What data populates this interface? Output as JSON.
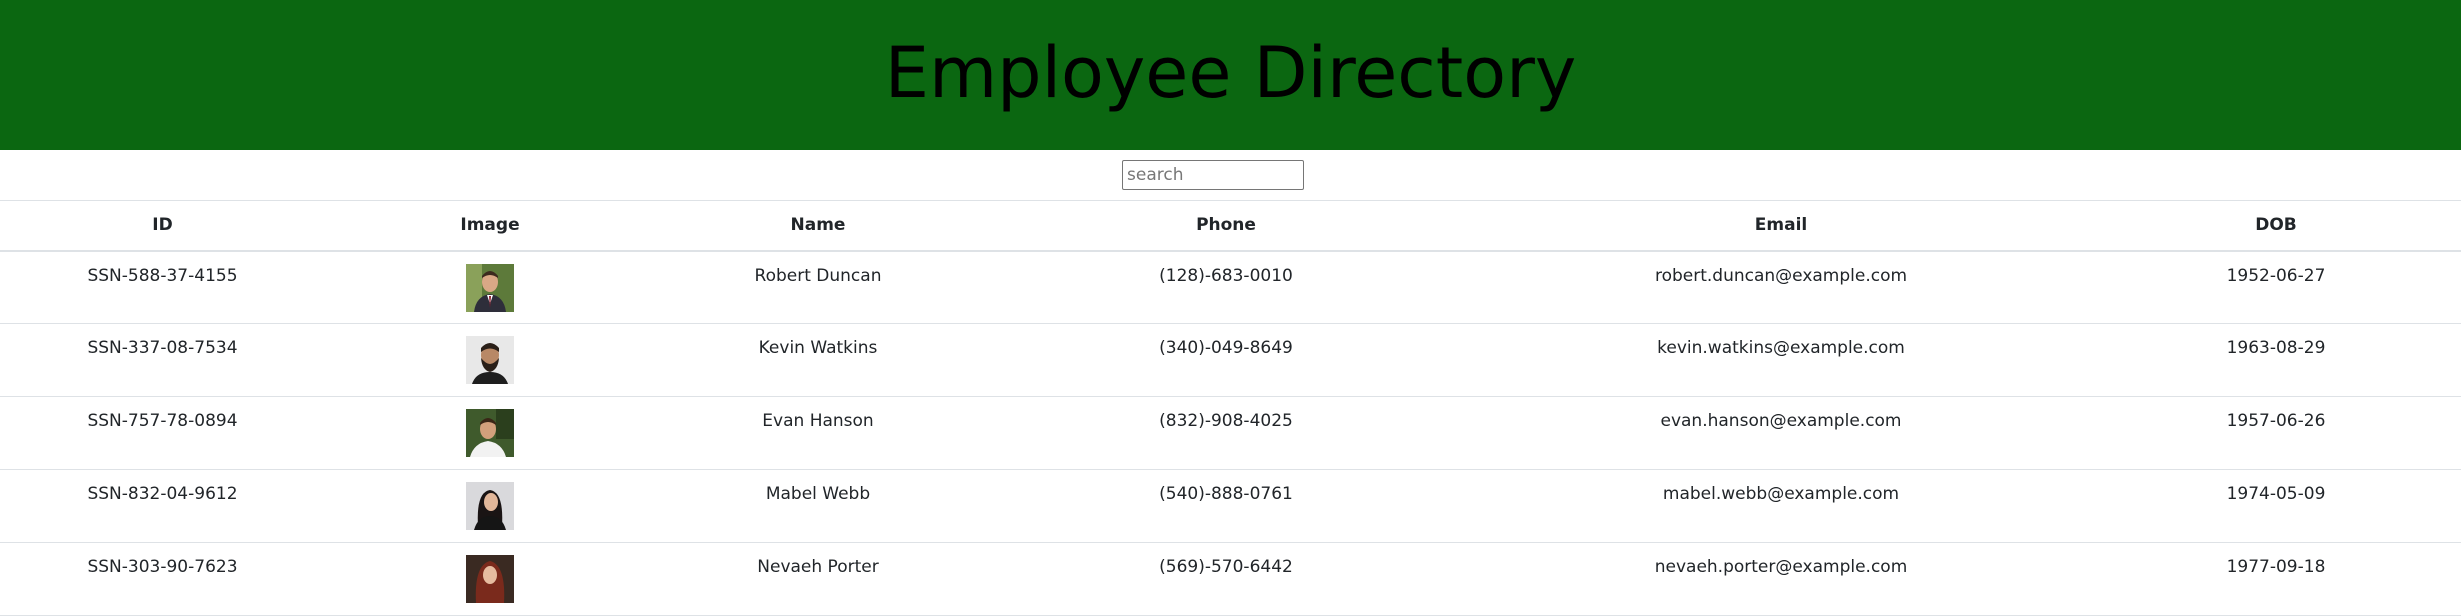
{
  "header": {
    "title": "Employee Directory",
    "background": "#0b6711"
  },
  "search": {
    "placeholder": "search",
    "value": ""
  },
  "table": {
    "columns": [
      "ID",
      "Image",
      "Name",
      "Phone",
      "Email",
      "DOB"
    ],
    "rows": [
      {
        "id": "SSN-588-37-4155",
        "name": "Robert Duncan",
        "phone": "(128)-683-0010",
        "email": "robert.duncan@example.com",
        "dob": "1952-06-27",
        "avatar": "man-in-suit-avatar"
      },
      {
        "id": "SSN-337-08-7534",
        "name": "Kevin Watkins",
        "phone": "(340)-049-8649",
        "email": "kevin.watkins@example.com",
        "dob": "1963-08-29",
        "avatar": "bearded-man-avatar"
      },
      {
        "id": "SSN-757-78-0894",
        "name": "Evan Hanson",
        "phone": "(832)-908-4025",
        "email": "evan.hanson@example.com",
        "dob": "1957-06-26",
        "avatar": "man-outdoors-avatar"
      },
      {
        "id": "SSN-832-04-9612",
        "name": "Mabel Webb",
        "phone": "(540)-888-0761",
        "email": "mabel.webb@example.com",
        "dob": "1974-05-09",
        "avatar": "woman-dark-hair-avatar"
      },
      {
        "id": "SSN-303-90-7623",
        "name": "Nevaeh Porter",
        "phone": "(569)-570-6442",
        "email": "nevaeh.porter@example.com",
        "dob": "1977-09-18",
        "avatar": "woman-red-hair-avatar"
      }
    ]
  }
}
